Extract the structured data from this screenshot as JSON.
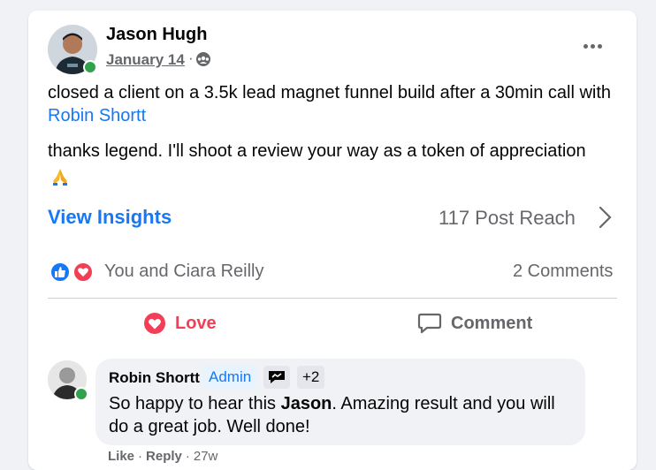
{
  "post": {
    "author": "Jason Hugh",
    "date": "January 14",
    "separator": "·",
    "privacy_icon": "group-privacy-icon",
    "paragraph1_text": "closed a client on a 3.5k lead magnet funnel build after a 30min call with ",
    "paragraph1_mention": "Robin Shortt",
    "paragraph2": "thanks legend. I'll shoot a review your way as a token of appreciation",
    "emoji": "folded-hands-emoji"
  },
  "insights": {
    "view_label": "View Insights",
    "reach": "117 Post Reach"
  },
  "reactions": {
    "icons": [
      "like-reaction-icon",
      "love-reaction-icon"
    ],
    "summary": "You and Ciara Reilly",
    "comments": "2 Comments"
  },
  "actions": {
    "love_label": "Love",
    "comment_label": "Comment"
  },
  "comment": {
    "author": "Robin Shortt",
    "admin_badge": "Admin",
    "extra_badges": "+2",
    "text_before": "So happy to hear this ",
    "text_bold": "Jason",
    "text_after": ". Amazing result and you will do a great job. Well done!",
    "like": "Like",
    "sep": "·",
    "reply": "Reply",
    "time": "27w"
  },
  "colors": {
    "accent": "#1877f2",
    "love": "#f33e58",
    "muted": "#65676b",
    "online": "#31a24c"
  }
}
